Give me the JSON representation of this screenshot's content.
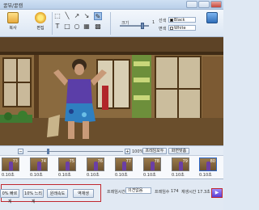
{
  "window": {
    "title": "꿀뷰/꿀캠"
  },
  "toolbar": {
    "buttons": [
      {
        "label": "복사",
        "icon": "copy-icon"
      },
      {
        "label": "편집",
        "icon": "edit-icon"
      }
    ],
    "tools": [
      "select-icon",
      "line-icon",
      "arrow-icon",
      "diagonal-arrow-icon",
      "crop-icon",
      "text-icon",
      "rectangle-icon",
      "ellipse-icon",
      "brush-icon",
      "mosaic-icon",
      "redo-icon",
      "pencil-icon"
    ],
    "size_label": "크기",
    "size_value": "1",
    "color_label": "선색",
    "color_value": "Black",
    "fill_label": "면색",
    "fill_value": "White",
    "accent": "#5b3dd1"
  },
  "preview": {
    "description": ""
  },
  "timeline": {
    "zoom_value": "100%",
    "zoom_button": "프레임모두",
    "fit_button": "화면맞춤",
    "frames": [
      {
        "num": "73",
        "dur": "0.10초"
      },
      {
        "num": "74",
        "dur": "0.10초"
      },
      {
        "num": "75",
        "dur": "0.10초"
      },
      {
        "num": "76",
        "dur": "0.10초"
      },
      {
        "num": "77",
        "dur": "0.10초"
      },
      {
        "num": "78",
        "dur": "0.10초"
      },
      {
        "num": "79",
        "dur": "0.10초"
      },
      {
        "num": "80",
        "dur": "0.10초"
      }
    ]
  },
  "bottom": {
    "buttons": [
      "0% 빠르게",
      "10% 느리게",
      "원래속도",
      "역재생"
    ],
    "frame_time_label": "프레임시간",
    "frame_time_value": "의견없음",
    "frame_count_label": "프레임수",
    "frame_count_value": "174",
    "play_time_label": "재생시간",
    "play_time_value": "17.3초"
  }
}
